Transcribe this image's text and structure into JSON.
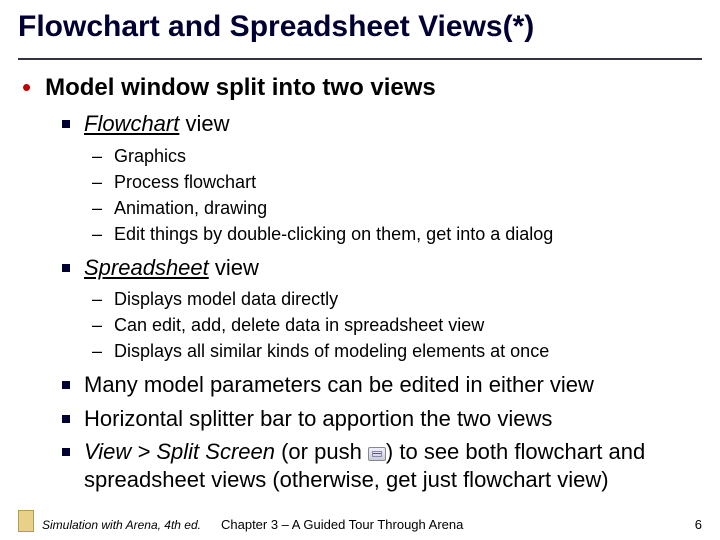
{
  "title": "Flowchart and Spreadsheet Views(*)",
  "lvl1_bullet": "•",
  "lvl1_item": "Model window split into two views",
  "lvl2": {
    "flow": {
      "underlined": "Flowchart",
      "rest": " view"
    },
    "flow_sub": [
      "Graphics",
      "Process flowchart",
      "Animation, drawing",
      "Edit things by double-clicking on them, get into a dialog"
    ],
    "sheet": {
      "underlined": "Spreadsheet",
      "rest": " view"
    },
    "sheet_sub": [
      "Displays model data directly",
      "Can edit, add, delete data in spreadsheet view",
      "Displays all similar kinds of modeling elements at once"
    ],
    "many": "Many model parameters can be edited in either view",
    "splitter": "Horizontal splitter bar to apportion the two views",
    "viewsplit": {
      "italic": "View > Split Screen",
      "mid": " (or push ",
      "after": ") to see both flowchart and spreadsheet views (otherwise, get just flowchart view)"
    }
  },
  "lvl3_bullet": "–",
  "footer": {
    "source": "Simulation with Arena, 4th ed.",
    "chapter": "Chapter 3 – A Guided Tour Through Arena",
    "page": "6"
  }
}
